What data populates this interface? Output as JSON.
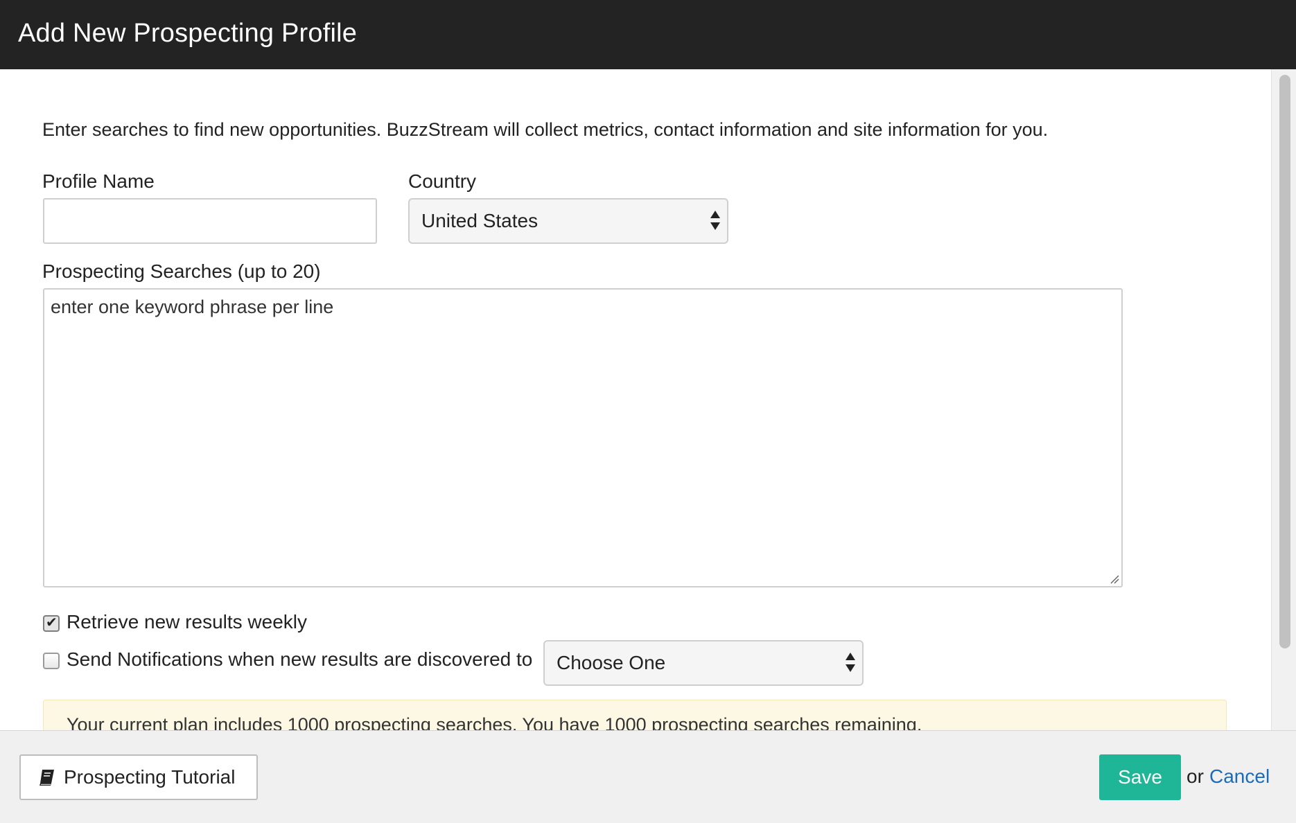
{
  "modal": {
    "title": "Add New Prospecting Profile"
  },
  "form": {
    "intro": "Enter searches to find new opportunities. BuzzStream will collect metrics, contact information and site information for you.",
    "profile_name": {
      "label": "Profile Name",
      "value": ""
    },
    "country": {
      "label": "Country",
      "selected": "United States"
    },
    "searches": {
      "label": "Prospecting Searches (up to 20)",
      "placeholder": "enter one keyword phrase per line"
    },
    "weekly": {
      "label": "Retrieve new results weekly",
      "checked": true
    },
    "notifications": {
      "label": "Send Notifications when new results are discovered to",
      "checked": false,
      "selected": "Choose One"
    },
    "plan_notice": "Your current plan includes 1000 prospecting searches. You have 1000 prospecting searches remaining."
  },
  "footer": {
    "tutorial_label": "Prospecting Tutorial",
    "tutorial_icon": "book-icon",
    "save_label": "Save",
    "or_text": "or",
    "cancel_label": "Cancel"
  },
  "colors": {
    "header_bg": "#232323",
    "save_bg": "#1fb597",
    "link": "#1a6bb8",
    "alert_bg": "#fcf8e3"
  }
}
